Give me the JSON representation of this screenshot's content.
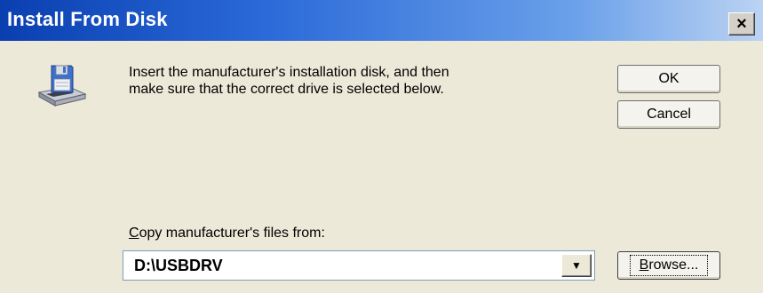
{
  "window": {
    "title": "Install From Disk",
    "close_glyph": "×"
  },
  "icon": "floppy-disk-drive-icon",
  "message": {
    "line1": "Insert the manufacturer's installation disk, and then",
    "line2": "make sure that the correct drive is selected below."
  },
  "buttons": {
    "ok": "OK",
    "cancel": "Cancel",
    "browse_first": "B",
    "browse_rest": "rowse..."
  },
  "copy": {
    "label_first": "C",
    "label_rest": "opy manufacturer's files from:",
    "value": "D:\\USBDRV",
    "arrow_glyph": "▼"
  },
  "colors": {
    "titlebar_start": "#0a3fb0",
    "titlebar_end": "#bcd3f2",
    "dialog_bg": "#ece9d8"
  }
}
